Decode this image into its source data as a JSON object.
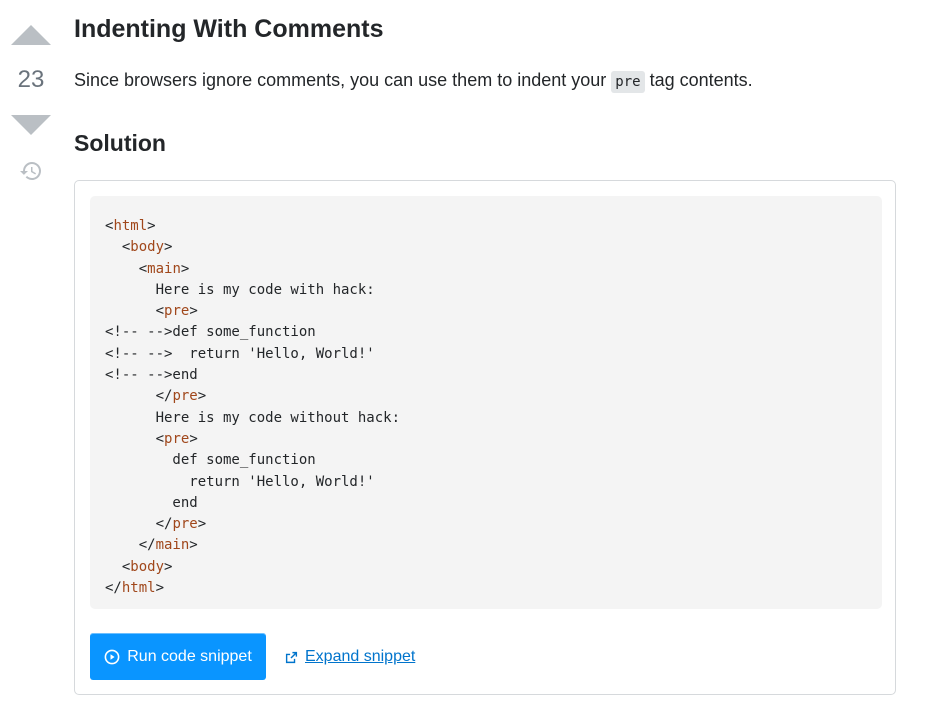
{
  "vote": {
    "count": "23"
  },
  "post": {
    "title": "Indenting With Comments",
    "intro_before": "Since browsers ignore comments, you can use them to indent your ",
    "intro_code": "pre",
    "intro_after": " tag contents.",
    "solution_heading": "Solution"
  },
  "snippet": {
    "code_lines": [
      [
        [
          "p",
          "<"
        ],
        [
          "t",
          "html"
        ],
        [
          "p",
          ">"
        ]
      ],
      [
        [
          "p",
          "  <"
        ],
        [
          "t",
          "body"
        ],
        [
          "p",
          ">"
        ]
      ],
      [
        [
          "p",
          "    <"
        ],
        [
          "t",
          "main"
        ],
        [
          "p",
          ">"
        ]
      ],
      [
        [
          "p",
          "      Here is my code with hack:"
        ]
      ],
      [
        [
          "p",
          "      <"
        ],
        [
          "t",
          "pre"
        ],
        [
          "p",
          ">"
        ]
      ],
      [
        [
          "p",
          "<!-- -->def some_function"
        ]
      ],
      [
        [
          "p",
          "<!-- -->  return 'Hello, World!'"
        ]
      ],
      [
        [
          "p",
          "<!-- -->end"
        ]
      ],
      [
        [
          "p",
          "      </"
        ],
        [
          "t",
          "pre"
        ],
        [
          "p",
          ">"
        ]
      ],
      [
        [
          "p",
          "      Here is my code without hack:"
        ]
      ],
      [
        [
          "p",
          "      <"
        ],
        [
          "t",
          "pre"
        ],
        [
          "p",
          ">"
        ]
      ],
      [
        [
          "p",
          "        def some_function"
        ]
      ],
      [
        [
          "p",
          "          return 'Hello, World!'"
        ]
      ],
      [
        [
          "p",
          "        end"
        ]
      ],
      [
        [
          "p",
          "      </"
        ],
        [
          "t",
          "pre"
        ],
        [
          "p",
          ">"
        ]
      ],
      [
        [
          "p",
          "    </"
        ],
        [
          "t",
          "main"
        ],
        [
          "p",
          ">"
        ]
      ],
      [
        [
          "p",
          "  <"
        ],
        [
          "t",
          "body"
        ],
        [
          "p",
          ">"
        ]
      ],
      [
        [
          "p",
          "</"
        ],
        [
          "t",
          "html"
        ],
        [
          "p",
          ">"
        ]
      ]
    ],
    "run_label": "Run code snippet",
    "expand_label": "Expand snippet"
  },
  "icons": {
    "vote_up": "arrow-up-icon",
    "vote_down": "arrow-down-icon",
    "history": "history-icon",
    "run": "play-circle-icon",
    "expand": "external-link-icon"
  },
  "colors": {
    "accent": "#0a95ff",
    "link": "#0074cc",
    "tag": "#a0471b",
    "code_bg": "#f4f4f4"
  }
}
